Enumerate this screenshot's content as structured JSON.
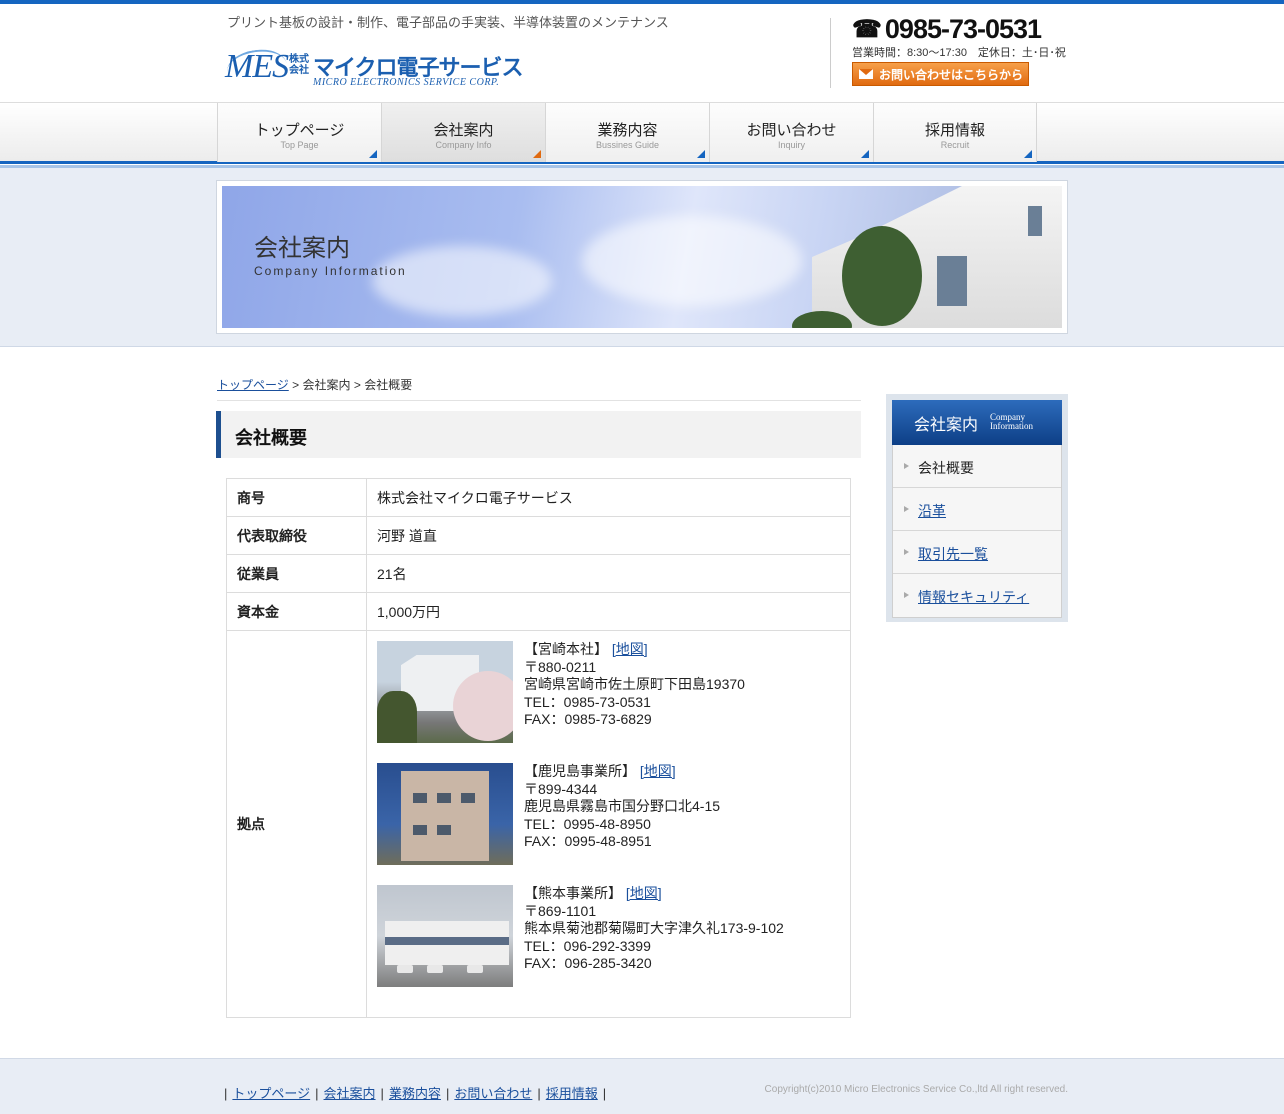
{
  "header": {
    "tagline": "プリント基板の設計・制作、電子部品の手実装、半導体装置のメンテナンス",
    "logo": {
      "mes": "MES",
      "kabushiki": "株式会社",
      "name": "マイクロ電子サービス",
      "sub": "MICRO ELECTRONICS SERVICE CORP."
    },
    "phone": "0985-73-0531",
    "hours": "営業時間：8:30～17:30　定休日：土･日･祝",
    "contact_button": "お問い合わせはこちらから"
  },
  "nav": [
    {
      "jp": "トップページ",
      "en": "Top Page",
      "active": false
    },
    {
      "jp": "会社案内",
      "en": "Company Info",
      "active": true
    },
    {
      "jp": "業務内容",
      "en": "Bussines Guide",
      "active": false
    },
    {
      "jp": "お問い合わせ",
      "en": "Inquiry",
      "active": false
    },
    {
      "jp": "採用情報",
      "en": "Recruit",
      "active": false
    }
  ],
  "banner": {
    "title": "会社案内",
    "subtitle": "Company Information"
  },
  "breadcrumb": {
    "home": "トップページ",
    "sep": ">",
    "level1": "会社案内",
    "level2": "会社概要"
  },
  "section_title": "会社概要",
  "info": {
    "rows": [
      {
        "key": "商号",
        "value": "株式会社マイクロ電子サービス"
      },
      {
        "key": "代表取締役",
        "value": "河野 道直"
      },
      {
        "key": "従業員",
        "value": "21名"
      },
      {
        "key": "資本金",
        "value": "1,000万円"
      }
    ],
    "bases_key": "拠点",
    "offices": [
      {
        "name": "【宮崎本社】",
        "map": "[地図]",
        "postal": "〒880-0211",
        "address": "宮崎県宮崎市佐土原町下田島19370",
        "tel": "TEL：0985-73-0531",
        "fax": "FAX：0985-73-6829"
      },
      {
        "name": "【鹿児島事業所】",
        "map": "[地図]",
        "postal": "〒899-4344",
        "address": "鹿児島県霧島市国分野口北4-15",
        "tel": "TEL：0995-48-8950",
        "fax": "FAX：0995-48-8951"
      },
      {
        "name": "【熊本事業所】",
        "map": "[地図]",
        "postal": "〒869-1101",
        "address": "熊本県菊池郡菊陽町大字津久礼173-9-102",
        "tel": "TEL：096-292-3399",
        "fax": "FAX：096-285-3420"
      }
    ]
  },
  "sidebar": {
    "title_jp": "会社案内",
    "title_en_1": "Company",
    "title_en_2": "Information",
    "items": [
      {
        "label": "会社概要",
        "link": false
      },
      {
        "label": "沿革",
        "link": true
      },
      {
        "label": "取引先一覧",
        "link": true
      },
      {
        "label": "情報セキュリティ",
        "link": true
      }
    ]
  },
  "footer": {
    "links": [
      "トップページ",
      "会社案内",
      "業務内容",
      "お問い合わせ",
      "採用情報"
    ],
    "sep": "|",
    "copyright": "Copyright(c)2010 Micro Electronics Service Co.,ltd All right reserved."
  },
  "colors": {
    "accent": "#1565c0",
    "nav_active_marker": "#e06a10",
    "link": "#1a4f9c",
    "contact_button": "#e06a10"
  }
}
